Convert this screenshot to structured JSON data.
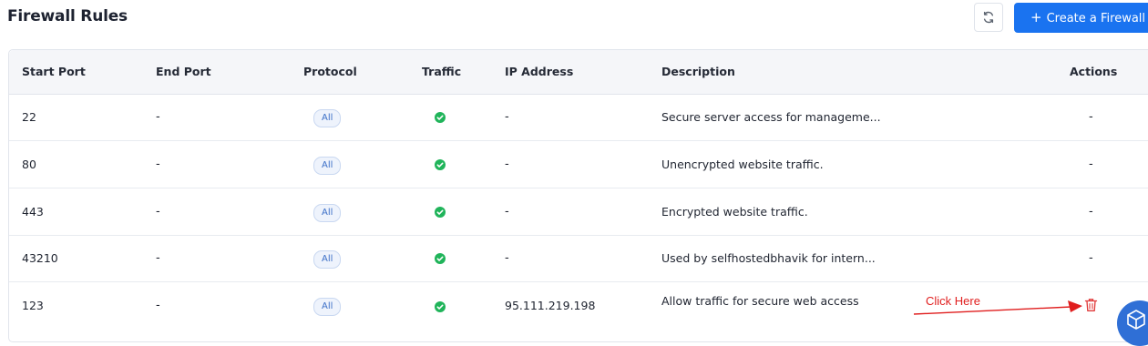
{
  "header": {
    "title": "Firewall Rules",
    "refresh_icon": "refresh-icon",
    "create_label": "Create a Firewall",
    "create_icon": "+"
  },
  "table": {
    "columns": [
      "Start Port",
      "End Port",
      "Protocol",
      "Traffic",
      "IP Address",
      "Description",
      "Actions"
    ],
    "rows": [
      {
        "start_port": "22",
        "end_port": "-",
        "protocol": "All",
        "traffic": "allowed",
        "ip": "-",
        "description": "Secure server access for manageme...",
        "action": "-"
      },
      {
        "start_port": "80",
        "end_port": "-",
        "protocol": "All",
        "traffic": "allowed",
        "ip": "-",
        "description": "Unencrypted website traffic.",
        "action": "-"
      },
      {
        "start_port": "443",
        "end_port": "-",
        "protocol": "All",
        "traffic": "allowed",
        "ip": "-",
        "description": "Encrypted website traffic.",
        "action": "-"
      },
      {
        "start_port": "43210",
        "end_port": "-",
        "protocol": "All",
        "traffic": "allowed",
        "ip": "-",
        "description": "Used by selfhostedbhavik for intern...",
        "action": "-"
      },
      {
        "start_port": "123",
        "end_port": "-",
        "protocol": "All",
        "traffic": "allowed",
        "ip": "95.111.219.198",
        "description": "Allow traffic for secure web access",
        "action": "trash-icon"
      }
    ]
  },
  "annotation": {
    "text": "Click Here",
    "color": "#e01e1e"
  },
  "colors": {
    "accent": "#1a73f0",
    "success": "#20b45a",
    "danger": "#e03a3a"
  }
}
